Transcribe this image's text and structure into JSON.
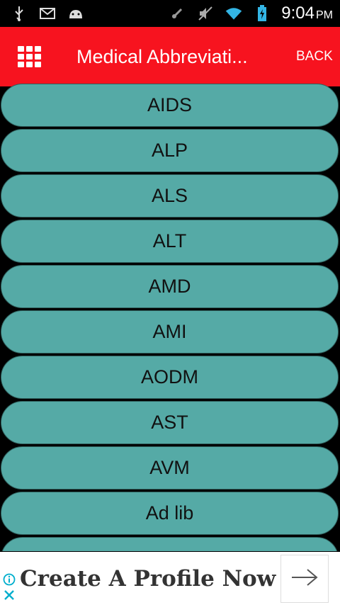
{
  "status_bar": {
    "time": "9:04",
    "ampm": "PM",
    "icons": [
      "usb-icon",
      "gmail-icon",
      "android-icon",
      "nfc-icon",
      "mute-icon",
      "wifi-icon",
      "battery-icon"
    ]
  },
  "app_bar": {
    "title": "Medical Abbreviati...",
    "back_label": "BACK",
    "menu_icon": "grid-menu-icon"
  },
  "list": {
    "items": [
      "AIDS",
      "ALP",
      "ALS",
      "ALT",
      "AMD",
      "AMI",
      "AODM",
      "AST",
      "AVM",
      "Ad lib",
      ""
    ]
  },
  "ad": {
    "text": "Create A Profile Now"
  },
  "colors": {
    "app_bar": "#f7131f",
    "item": "#55aaa6",
    "background": "#000000"
  }
}
